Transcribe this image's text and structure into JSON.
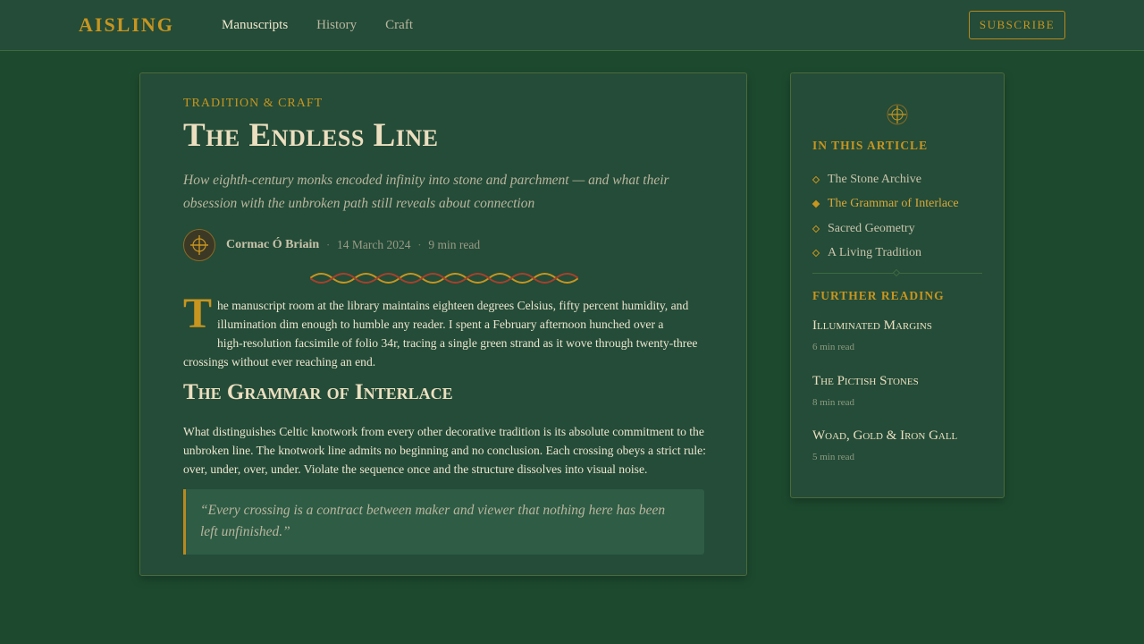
{
  "header": {
    "logo": "AISLING",
    "nav": [
      {
        "label": "Manuscripts",
        "active": true
      },
      {
        "label": "History",
        "active": false
      },
      {
        "label": "Craft",
        "active": false
      }
    ],
    "subscribe_label": "SUBSCRIBE"
  },
  "article": {
    "kicker": "TRADITION & CRAFT",
    "title": "The Endless Line",
    "dek": "How eighth-century monks encoded infinity into stone and parchment — and what their obsession with the unbroken path still reveals about connection",
    "author": "Cormac Ó Briain",
    "date": "14 March 2024",
    "read_time": "9 min read",
    "drop_cap": "T",
    "para1_lines": [
      "he manuscript room at the library maintains eighteen degrees Celsius, fifty percent humidity, and",
      "illumination dim enough to humble any reader. I spent a February afternoon hunched over a",
      "high-resolution facsimile of folio 34r, tracing a single green strand as it wove through twenty-three",
      "crossings without ever reaching an end."
    ],
    "section_heading": "The Grammar of Interlace",
    "para2": "What distinguishes Celtic knotwork from every other decorative tradition is its absolute commitment to the unbroken line. The knotwork line admits no beginning and no conclusion. Each crossing obeys a strict rule: over, under, over, under. Violate the sequence once and the structure dissolves into visual noise.",
    "quote": "“Every crossing is a contract between maker and viewer that nothing here has been left unfinished.”"
  },
  "sidebar": {
    "toc_heading": "IN THIS ARTICLE",
    "toc": [
      {
        "label": "The Stone Archive",
        "active": false
      },
      {
        "label": "The Grammar of Interlace",
        "active": true
      },
      {
        "label": "Sacred Geometry",
        "active": false
      },
      {
        "label": "A Living Tradition",
        "active": false
      }
    ],
    "further_heading": "FURTHER READING",
    "further": [
      {
        "title": "Illuminated Margins",
        "time": "6 min read"
      },
      {
        "title": "The Pictish Stones",
        "time": "8 min read"
      },
      {
        "title": "Woad, Gold & Iron Gall",
        "time": "5 min read"
      }
    ]
  },
  "colors": {
    "background": "#1d4a2f",
    "panel": "#244c38",
    "accent_gold": "#c8951f",
    "text_cream": "#ecdfc0",
    "knot_red": "#a8402c"
  },
  "icons": {
    "avatar": "celtic-cross-icon",
    "sidebar_emblem": "celtic-cross-icon",
    "divider": "knotwork-divider",
    "toc_bullet": "diamond-icon"
  }
}
